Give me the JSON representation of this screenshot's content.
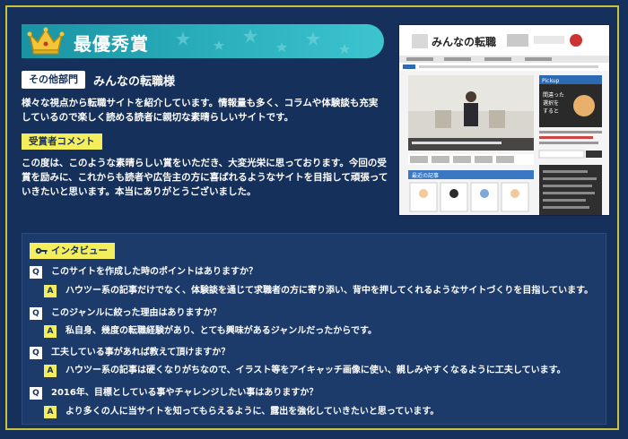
{
  "award": {
    "title": "最優秀賞"
  },
  "category": {
    "label": "その他部門",
    "site_name": "みんなの転職様"
  },
  "description": "様々な視点から転職サイトを紹介しています。情報量も多く、コラムや体験談も充実しているので楽しく読める読者に親切な素晴らしいサイトです。",
  "comment_section": {
    "label": "受賞者コメント",
    "text": "この度は、このような素晴らしい賞をいただき、大変光栄に思っております。今回の受賞を励みに、これからも読者や広告主の方に喜ばれるようなサイトを目指して頑張っていきたいと思います。本当にありがとうございました。"
  },
  "screenshot": {
    "site_logo": "みんなの転職",
    "pickup_label": "Pickup",
    "pickup_text": "間違った選択をすると損する!?",
    "recent_label": "最近の記事"
  },
  "interview": {
    "label": "インタビュー",
    "q_mark": "Q",
    "a_mark": "A",
    "items": [
      {
        "q": "このサイトを作成した時のポイントはありますか？",
        "a": "ハウツー系の記事だけでなく、体験談を通じて求職者の方に寄り添い、背中を押してくれるようなサイトづくりを目指しています。"
      },
      {
        "q": "このジャンルに絞った理由はありますか？",
        "a": "私自身、幾度の転職経験があり、とても興味があるジャンルだったからです。"
      },
      {
        "q": "工夫している事があれば教えて頂けますか？",
        "a": "ハウツー系の記事は硬くなりがちなので、イラスト等をアイキャッチ画像に使い、親しみやすくなるように工夫しています。"
      },
      {
        "q": "2016年、目標としている事やチャレンジしたい事はありますか？",
        "a": "より多くの人に当サイトを知ってもらえるように、露出を強化していきたいと思っています。"
      }
    ]
  }
}
